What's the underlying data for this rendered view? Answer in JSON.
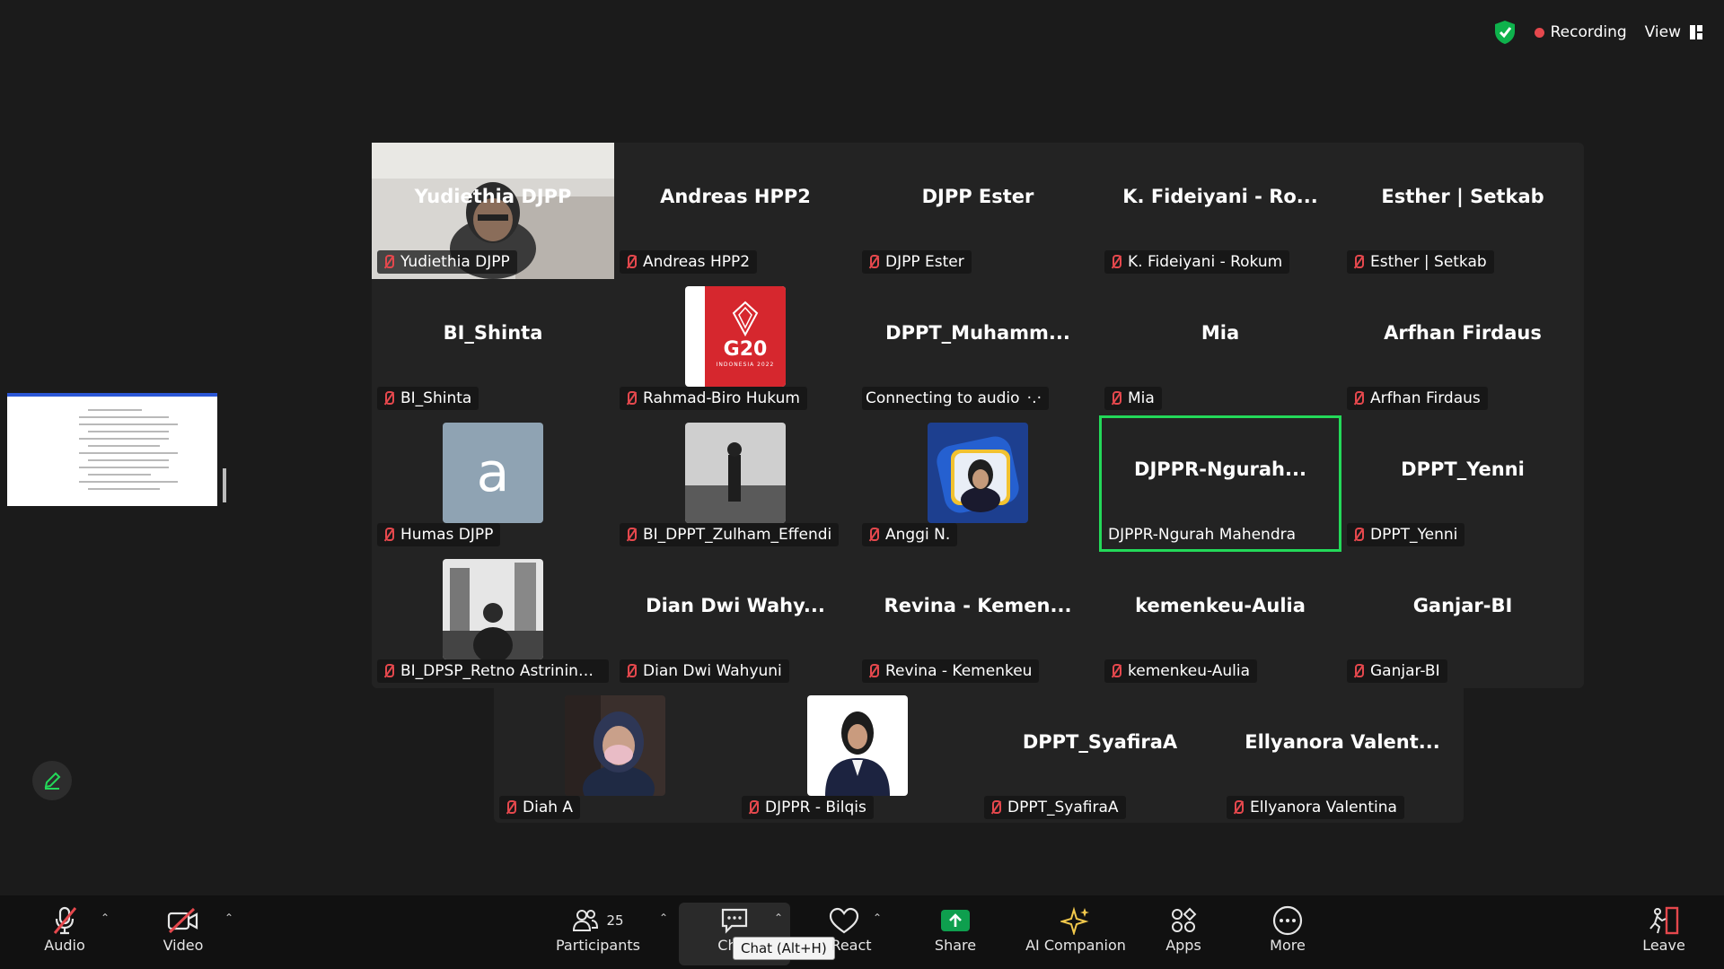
{
  "top_bar": {
    "recording_label": "Recording",
    "view_label": "View"
  },
  "tiles": [
    {
      "name": "Yudiethia DJPP",
      "label": "Yudiethia DJPP",
      "type": "video"
    },
    {
      "name": "Andreas HPP2",
      "label": "Andreas HPP2",
      "type": "name"
    },
    {
      "name": "DJPP Ester",
      "label": "DJPP Ester",
      "type": "name"
    },
    {
      "name": "K. Fideiyani - Ro...",
      "label": "K. Fideiyani - Rokum",
      "type": "name"
    },
    {
      "name": "Esther | Setkab",
      "label": "Esther | Setkab",
      "type": "name"
    },
    {
      "name": "BI_Shinta",
      "label": "BI_Shinta",
      "type": "name"
    },
    {
      "name": "",
      "label": "Rahmad-Biro Hukum",
      "type": "g20",
      "logo_text": "G20",
      "logo_sub": "INDONESIA 2022"
    },
    {
      "name": "DPPT_Muhamm...",
      "label": "Connecting to audio",
      "type": "name",
      "no_mic": true
    },
    {
      "name": "Mia",
      "label": "Mia",
      "type": "name"
    },
    {
      "name": "Arfhan Firdaus",
      "label": "Arfhan Firdaus",
      "type": "name"
    },
    {
      "name": "",
      "label": "Humas DJPP",
      "type": "letter",
      "letter": "a"
    },
    {
      "name": "",
      "label": "BI_DPPT_Zulham_Effendi",
      "type": "photo_bw"
    },
    {
      "name": "",
      "label": "Anggi N.",
      "type": "photo_blue"
    },
    {
      "name": "DJPPR-Ngurah...",
      "label": "DJPPR-Ngurah Mahendra",
      "type": "name",
      "active": true,
      "no_mic": true
    },
    {
      "name": "DPPT_Yenni",
      "label": "DPPT_Yenni",
      "type": "name"
    },
    {
      "name": "",
      "label": "BI_DPSP_Retno Astriningtya...",
      "type": "photo_city"
    },
    {
      "name": "Dian Dwi Wahy...",
      "label": "Dian Dwi Wahyuni",
      "type": "name"
    },
    {
      "name": "Revina - Kemen...",
      "label": "Revina - Kemenkeu",
      "type": "name"
    },
    {
      "name": "kemenkeu-Aulia",
      "label": "kemenkeu-Aulia",
      "type": "name"
    },
    {
      "name": "Ganjar-BI",
      "label": "Ganjar-BI",
      "type": "name"
    },
    {
      "name": "",
      "label": "Diah A",
      "type": "photo_mask"
    },
    {
      "name": "",
      "label": "DJPPR - Bilqis",
      "type": "photo_formal"
    },
    {
      "name": "DPPT_SyafiraA",
      "label": "DPPT_SyafiraA",
      "type": "name"
    },
    {
      "name": "Ellyanora Valent...",
      "label": "Ellyanora Valentina",
      "type": "name"
    }
  ],
  "toolbar": {
    "audio_label": "Audio",
    "video_label": "Video",
    "participants_label": "Participants",
    "participants_count": "25",
    "chat_label": "Chat",
    "chat_tooltip": "Chat (Alt+H)",
    "react_label": "React",
    "share_label": "Share",
    "ai_label": "AI Companion",
    "apps_label": "Apps",
    "more_label": "More",
    "leave_label": "Leave"
  },
  "colors": {
    "active_speaker": "#23d959",
    "muted": "#e5484d",
    "share": "#0e9f4e",
    "leave": "#e5484d"
  }
}
